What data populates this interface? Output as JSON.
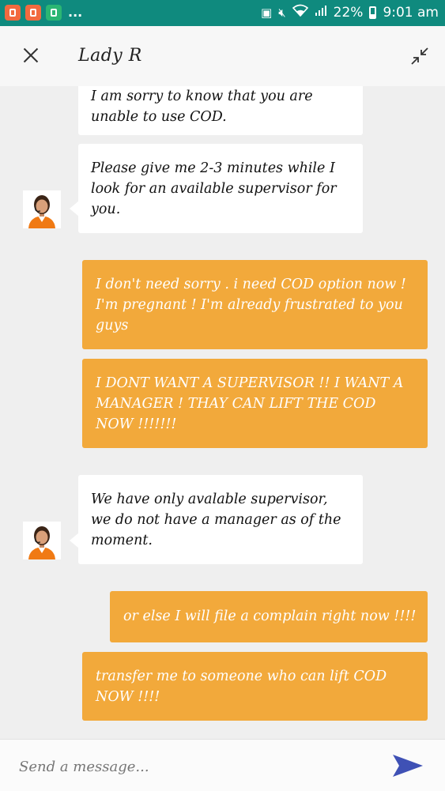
{
  "status_bar": {
    "battery": "22%",
    "time": "9:01 am",
    "overflow": "..."
  },
  "header": {
    "title": "Lady R"
  },
  "messages": [
    {
      "sender": "agent",
      "text": "I am sorry to know that you are unable to use COD."
    },
    {
      "sender": "agent",
      "text": "Please give me 2-3 minutes while I look for an available supervisor for you."
    },
    {
      "sender": "user",
      "text": "I don't need sorry . i need COD option now ! I'm pregnant ! I'm already frustrated to you guys"
    },
    {
      "sender": "user",
      "text": "I DONT WANT A SUPERVISOR !! I WANT A MANAGER ! THAY CAN LIFT THE COD NOW !!!!!!!"
    },
    {
      "sender": "agent",
      "text": "We have only avalable supervisor, we do not have a manager as of the moment."
    },
    {
      "sender": "user",
      "text": "or else I will file a complain right now !!!!"
    },
    {
      "sender": "user",
      "text": "transfer me to someone who can lift COD NOW !!!!"
    }
  ],
  "composer": {
    "placeholder": "Send a message..."
  },
  "colors": {
    "status_bar": "#0f8a7e",
    "user_bubble": "#f2a93b",
    "agent_bubble": "#ffffff",
    "chat_background": "#efefef",
    "send_icon": "#3f51b5"
  }
}
